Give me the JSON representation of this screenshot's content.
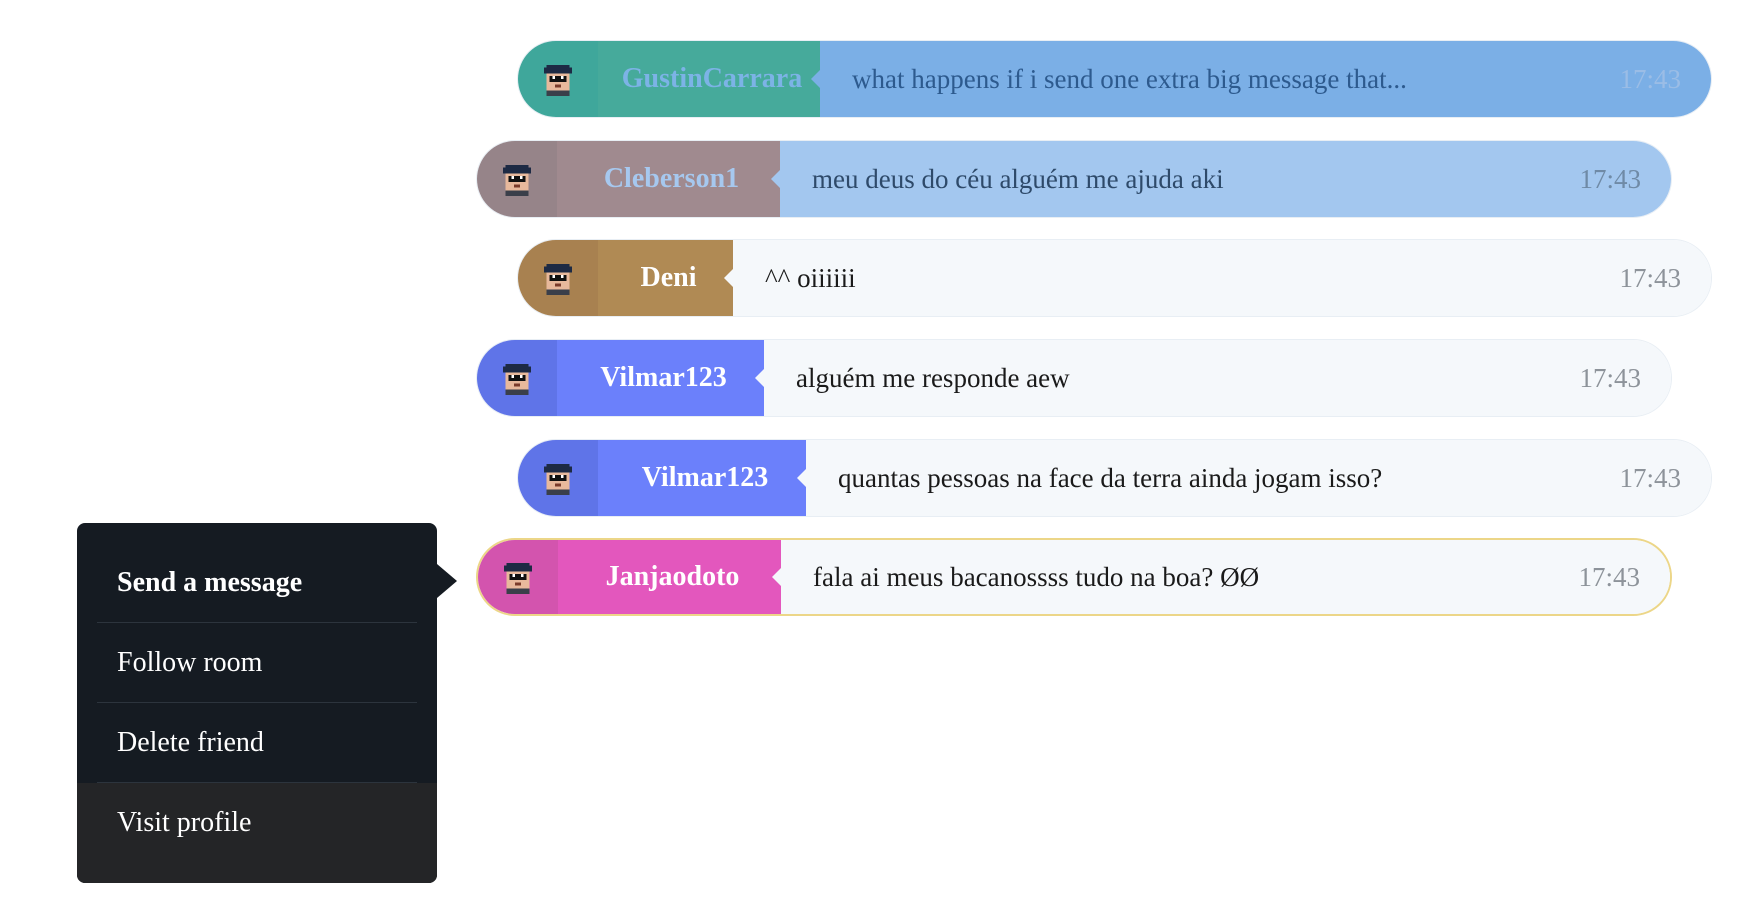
{
  "messages": [
    {
      "username": "GustinCarrara",
      "text": "what happens if i send one extra big message that...",
      "time": "17:43",
      "avatar_icon": "pixel-avatar-icon",
      "colors": {
        "avatar_bg": "#3fa79b",
        "name_bg": "#46aa9b",
        "name_fg": "#7cb3e6",
        "msg_bg": "#7bafe6",
        "msg_fg": "#2d5a8e",
        "time_fg": "#9bbde6"
      }
    },
    {
      "username": "Cleberson1",
      "text": "meu deus do céu alguém me ajuda aki",
      "time": "17:43",
      "avatar_icon": "pixel-avatar-icon",
      "colors": {
        "avatar_bg": "#968489",
        "name_bg": "#a08a8f",
        "name_fg": "#a6c8ef",
        "msg_bg": "#a3c7ef",
        "msg_fg": "#2e4a6a",
        "time_fg": "#6f8aa6"
      }
    },
    {
      "username": "Deni",
      "text": "^^ oiiiiii",
      "time": "17:43",
      "avatar_icon": "pixel-avatar-icon",
      "colors": {
        "avatar_bg": "#a88150",
        "name_bg": "#b08a54",
        "name_fg": "#ffffff",
        "msg_bg": "#f5f8fb",
        "msg_fg": "#1a1a1a",
        "time_fg": "#8d939a"
      }
    },
    {
      "username": "Vilmar123",
      "text": "alguém me responde aew",
      "time": "17:43",
      "avatar_icon": "pixel-avatar-icon",
      "colors": {
        "avatar_bg": "#5f74e8",
        "name_bg": "#6b80fb",
        "name_fg": "#ffffff",
        "msg_bg": "#f5f8fb",
        "msg_fg": "#1a1a1a",
        "time_fg": "#8d939a"
      }
    },
    {
      "username": "Vilmar123",
      "text": "quantas pessoas na face da terra ainda jogam isso?",
      "time": "17:43",
      "avatar_icon": "pixel-avatar-icon",
      "colors": {
        "avatar_bg": "#5f74e8",
        "name_bg": "#6b80fb",
        "name_fg": "#ffffff",
        "msg_bg": "#f5f8fb",
        "msg_fg": "#1a1a1a",
        "time_fg": "#8d939a"
      }
    },
    {
      "username": "Janjaodoto",
      "text": "fala ai meus bacanossss tudo na boa? ØØ",
      "time": "17:43",
      "avatar_icon": "pixel-avatar-icon",
      "colors": {
        "avatar_bg": "#d354ae",
        "name_bg": "#e357bd",
        "name_fg": "#ffffff",
        "msg_bg": "#f5f8fb",
        "msg_fg": "#1a1a1a",
        "time_fg": "#8d939a",
        "border": "#ecd688"
      }
    }
  ],
  "context_menu": {
    "items": [
      {
        "label": "Send a message"
      },
      {
        "label": "Follow room"
      },
      {
        "label": "Delete friend"
      },
      {
        "label": "Visit profile"
      }
    ],
    "colors": {
      "bg": "#151b22",
      "hover_bg": "#242527",
      "fg": "#ffffff"
    }
  }
}
